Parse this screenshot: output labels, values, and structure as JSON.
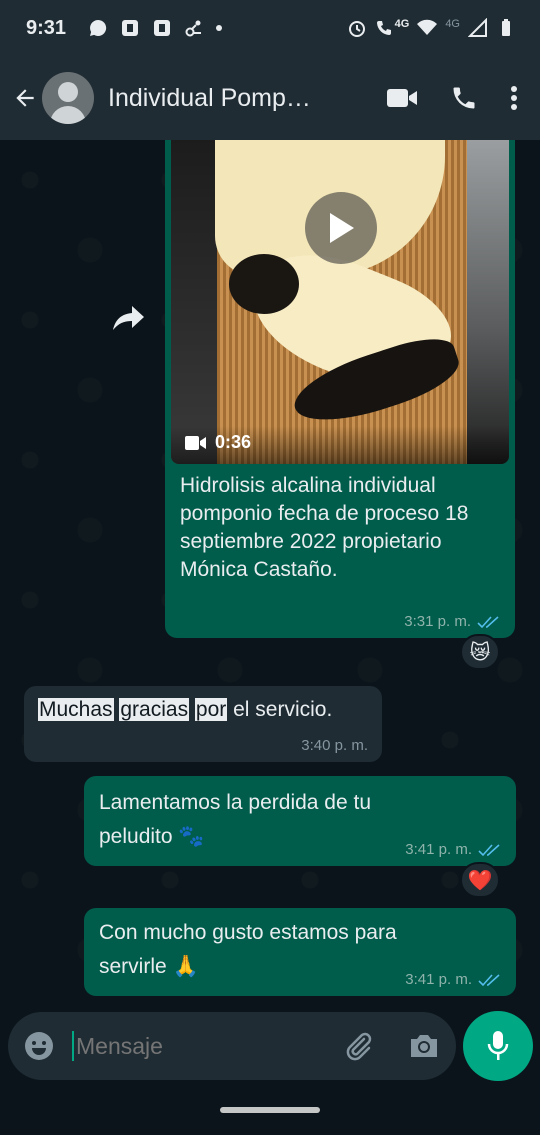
{
  "status_bar": {
    "time": "9:31",
    "network_label_1": "4G",
    "network_label_2": "4G"
  },
  "header": {
    "title": "Individual Pomp…",
    "icons": [
      "back-arrow-icon",
      "video-call-icon",
      "phone-icon",
      "more-vert-icon"
    ]
  },
  "messages": [
    {
      "type": "video",
      "direction": "outgoing",
      "duration": "0:36",
      "caption": "Hidrolisis alcalina individual pomponio fecha de proceso 18 septiembre 2022 propietario Mónica Castaño.",
      "time": "3:31 p. m.",
      "reaction": "😿"
    },
    {
      "type": "text",
      "direction": "incoming",
      "highlighted_words": [
        "Muchas",
        "gracias",
        "por"
      ],
      "text_rest": " el servicio.",
      "time": "3:40 p. m."
    },
    {
      "type": "text",
      "direction": "outgoing",
      "text": "Lamentamos la perdida de tu peludito 🐾",
      "time": "3:41 p. m.",
      "reaction": "❤️"
    },
    {
      "type": "text",
      "direction": "outgoing",
      "text": "Con mucho gusto estamos para servirle 🙏",
      "time": "3:41 p. m."
    }
  ],
  "composer": {
    "placeholder": "Mensaje"
  },
  "colors": {
    "outgoing_bubble": "#005c4b",
    "incoming_bubble": "#1f2c34",
    "accent": "#00a884",
    "read_ticks": "#53bdeb"
  }
}
